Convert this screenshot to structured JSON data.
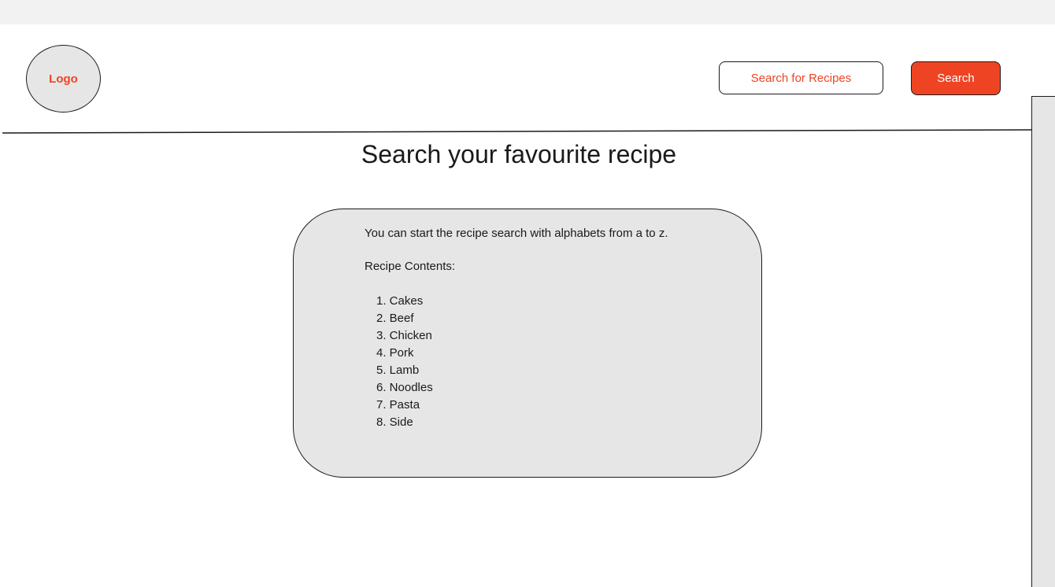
{
  "header": {
    "logo_label": "Logo",
    "search_placeholder": "Search for Recipes",
    "search_button_label": "Search"
  },
  "main": {
    "title": "Search your favourite recipe",
    "card": {
      "intro": "You can start the recipe search with alphabets from a to z.",
      "contents_label": "Recipe Contents:",
      "items": [
        {
          "text": "1. Cakes"
        },
        {
          "text": "2. Beef"
        },
        {
          "text": "3. Chicken"
        },
        {
          "text": "4. Pork"
        },
        {
          "text": "5. Lamb"
        },
        {
          "text": "6. Noodles"
        },
        {
          "text": "7. Pasta"
        },
        {
          "text": "8. Side"
        }
      ]
    }
  },
  "colors": {
    "accent": "#ee4423",
    "card_fill": "#e6e6e6",
    "topbar": "#f2f2f2",
    "border": "#1a1a1a"
  }
}
